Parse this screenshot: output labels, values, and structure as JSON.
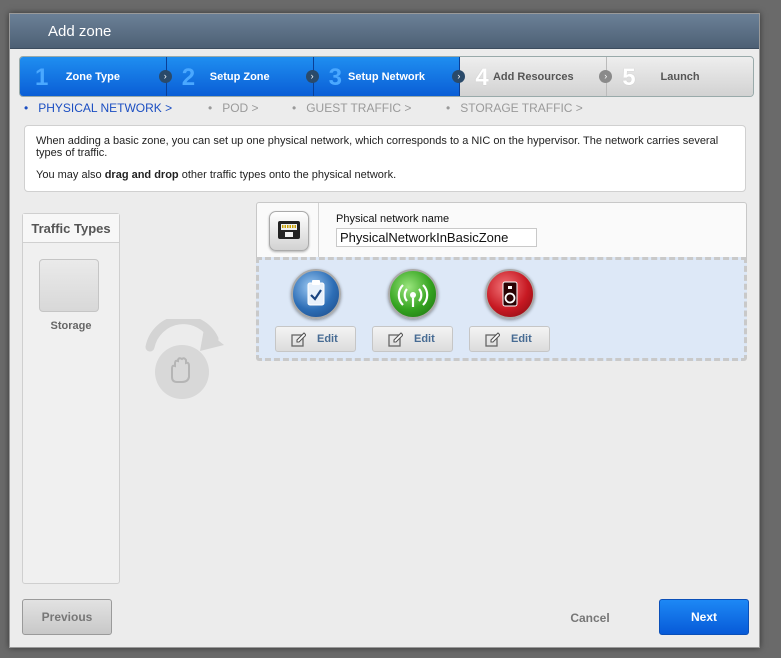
{
  "dialog": {
    "title": "Add zone"
  },
  "steps": [
    {
      "number": "1",
      "label": "Zone Type",
      "state": "active"
    },
    {
      "number": "2",
      "label": "Setup Zone",
      "state": "active"
    },
    {
      "number": "3",
      "label": "Setup Network",
      "state": "active"
    },
    {
      "number": "4",
      "label": "Add Resources",
      "state": "inactive"
    },
    {
      "number": "5",
      "label": "Launch",
      "state": "inactive"
    }
  ],
  "substeps": [
    {
      "label": "PHYSICAL NETWORK >",
      "state": "current"
    },
    {
      "label": "POD >",
      "state": "future"
    },
    {
      "label": "GUEST TRAFFIC >",
      "state": "future"
    },
    {
      "label": "STORAGE TRAFFIC >",
      "state": "future"
    }
  ],
  "substep_bullet": "•",
  "info": {
    "line1": "When adding a basic zone, you can set up one physical network, which corresponds to a NIC on the hypervisor. The network carries several types of traffic.",
    "line2_prefix": "You may also ",
    "line2_bold": "drag and drop",
    "line2_suffix": " other traffic types onto the physical network."
  },
  "traffic_types": {
    "header": "Traffic Types",
    "items": [
      {
        "label": "Storage"
      }
    ]
  },
  "physical_network": {
    "name_label": "Physical network name",
    "name_value": "PhysicalNetworkInBasicZone",
    "traffic": [
      {
        "icon": "management-traffic-icon",
        "edit_label": "Edit"
      },
      {
        "icon": "guest-traffic-icon",
        "edit_label": "Edit"
      },
      {
        "icon": "public-traffic-icon",
        "edit_label": "Edit"
      }
    ]
  },
  "buttons": {
    "previous": "Previous",
    "cancel": "Cancel",
    "next": "Next"
  },
  "colors": {
    "accent": "#0a5ed6",
    "title_bar": "#5a6e84",
    "substep_current": "#1b4ec2"
  }
}
